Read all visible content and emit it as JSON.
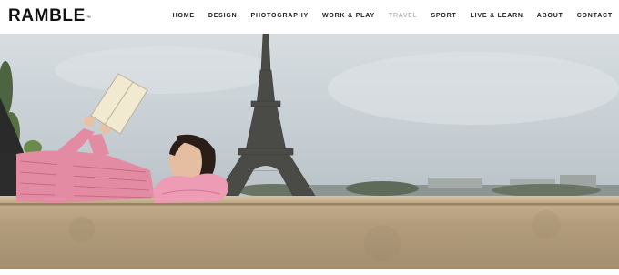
{
  "brand": {
    "logo": "RAMBLE",
    "trademark": "™"
  },
  "nav": {
    "items": [
      {
        "label": "HOME",
        "active": false
      },
      {
        "label": "DESIGN",
        "active": false
      },
      {
        "label": "PHOTOGRAPHY",
        "active": false
      },
      {
        "label": "WORK & PLAY",
        "active": false
      },
      {
        "label": "TRAVEL",
        "active": true
      },
      {
        "label": "SPORT",
        "active": false
      },
      {
        "label": "LIVE & LEARN",
        "active": false
      },
      {
        "label": "ABOUT",
        "active": false
      },
      {
        "label": "CONTACT",
        "active": false
      }
    ]
  },
  "hero": {
    "scene": "woman-reading-book-lying-on-wall-eiffel-tower",
    "colors": {
      "sky": "#c9d1d6",
      "wall": "#b59f7f",
      "sweater": "#e58aa3",
      "tower": "#4a4a46"
    }
  }
}
